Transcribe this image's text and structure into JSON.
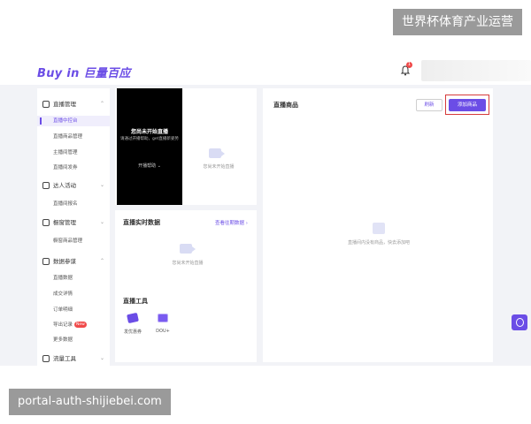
{
  "watermarks": {
    "top": "世界杯体育产业运营",
    "bottom": "portal-auth-shijiebei.com"
  },
  "header": {
    "brand": "Buy in 巨量百应",
    "notification_count": "1"
  },
  "sidebar": {
    "groups": [
      {
        "label": "直播管理",
        "icon": "tv-icon",
        "items": [
          {
            "label": "直播中控台",
            "active": true
          },
          {
            "label": "直播商品管理"
          },
          {
            "label": "主播间管理"
          },
          {
            "label": "直播间发券"
          }
        ]
      },
      {
        "label": "达人活动",
        "icon": "people-icon",
        "items": [
          {
            "label": "直播间报名"
          }
        ]
      },
      {
        "label": "橱窗管理",
        "icon": "window-icon",
        "items": [
          {
            "label": "橱窗商品管理"
          }
        ]
      },
      {
        "label": "数据参谋",
        "icon": "chart-icon",
        "items": [
          {
            "label": "直播数据"
          },
          {
            "label": "成交详情"
          },
          {
            "label": "订单明细"
          },
          {
            "label": "导出记录",
            "badge": "New"
          },
          {
            "label": "更多数据"
          }
        ]
      },
      {
        "label": "流量工具",
        "icon": "traffic-icon",
        "items": []
      }
    ]
  },
  "preview": {
    "title": "您尚未开始直播",
    "subtitle": "请通过开播帮助，get直播新姿势",
    "help": "开播帮助",
    "empty_text": "您尚未开始直播"
  },
  "realtime": {
    "title": "直播实时数据",
    "link": "查看往期数据",
    "empty_text": "您尚未开始直播"
  },
  "tools": {
    "title": "直播工具",
    "items": [
      {
        "label": "发优惠券",
        "icon": "coupon-icon"
      },
      {
        "label": "DOU+",
        "icon": "dou-icon"
      }
    ]
  },
  "goods": {
    "title": "直播商品",
    "refresh_label": "刷新",
    "add_label": "添加商品",
    "empty_text": "直播间内没有商品，快去添加吧"
  },
  "colors": {
    "accent": "#6b4de6",
    "highlight": "#d63b3b",
    "badge": "#f04a4a"
  }
}
